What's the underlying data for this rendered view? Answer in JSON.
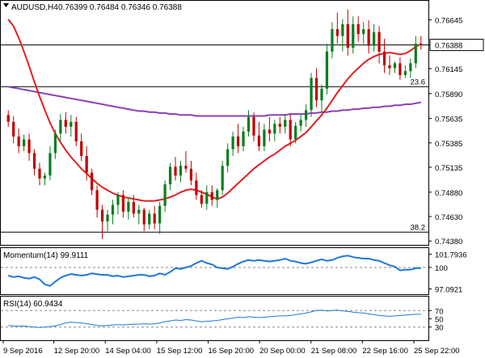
{
  "chart_data": [
    {
      "type": "candlestick",
      "header": {
        "symbol": "AUDUSD,H4",
        "ohlc": "0.76399 0.76484 0.76346 0.76388"
      },
      "y_ticks": [
        "0.76645",
        "0.76388",
        "0.76145",
        "0.75890",
        "0.75635",
        "0.75385",
        "0.75135",
        "0.74880",
        "0.74630",
        "0.74380"
      ],
      "y_tick_values": [
        0.76645,
        0.76388,
        0.76145,
        0.7589,
        0.75635,
        0.75385,
        0.75135,
        0.7488,
        0.7463,
        0.7438
      ],
      "ylim": [
        0.7434,
        0.7684
      ],
      "x_labels": [
        "9 Sep 2016",
        "12 Sep 20:00",
        "14 Sep 04:00",
        "15 Sep 12:00",
        "16 Sep 20:00",
        "20 Sep 00:00",
        "21 Sep 08:00",
        "22 Sep 16:00",
        "25 Sep 22:00"
      ],
      "current_price": 0.76388,
      "fib_levels": [
        {
          "label": "23.6",
          "value": 0.7596
        },
        {
          "label": "38.2",
          "value": 0.7447
        }
      ],
      "up_color": "#0a7d1e",
      "down_color": "#c00000",
      "candles": [
        [
          0.7567,
          0.7572,
          0.7555,
          0.756
        ],
        [
          0.756,
          0.7566,
          0.7538,
          0.7545
        ],
        [
          0.7545,
          0.7553,
          0.7528,
          0.7535
        ],
        [
          0.7535,
          0.7547,
          0.753,
          0.7542
        ],
        [
          0.7542,
          0.7548,
          0.752,
          0.7528
        ],
        [
          0.7528,
          0.7532,
          0.7505,
          0.7512
        ],
        [
          0.7512,
          0.7518,
          0.7495,
          0.7502
        ],
        [
          0.7502,
          0.7508,
          0.7495,
          0.7505
        ],
        [
          0.7505,
          0.7535,
          0.75,
          0.7528
        ],
        [
          0.7528,
          0.7552,
          0.7522,
          0.7548
        ],
        [
          0.7548,
          0.7568,
          0.754,
          0.7562
        ],
        [
          0.7562,
          0.757,
          0.7548,
          0.7555
        ],
        [
          0.7555,
          0.7567,
          0.7545,
          0.756
        ],
        [
          0.756,
          0.7565,
          0.7535,
          0.754
        ],
        [
          0.754,
          0.7548,
          0.752,
          0.7525
        ],
        [
          0.7525,
          0.7535,
          0.75,
          0.7508
        ],
        [
          0.7508,
          0.7512,
          0.7485,
          0.749
        ],
        [
          0.749,
          0.7495,
          0.7462,
          0.747
        ],
        [
          0.747,
          0.7475,
          0.744,
          0.7458
        ],
        [
          0.7458,
          0.747,
          0.7448,
          0.7465
        ],
        [
          0.7465,
          0.748,
          0.7455,
          0.7475
        ],
        [
          0.7475,
          0.7488,
          0.7465,
          0.7485
        ],
        [
          0.7485,
          0.749,
          0.7462,
          0.7468
        ],
        [
          0.7468,
          0.7482,
          0.746,
          0.7478
        ],
        [
          0.7478,
          0.7485,
          0.7462,
          0.7466
        ],
        [
          0.7466,
          0.7475,
          0.7455,
          0.747
        ],
        [
          0.747,
          0.7472,
          0.7448,
          0.7455
        ],
        [
          0.7455,
          0.747,
          0.745,
          0.7466
        ],
        [
          0.7466,
          0.7474,
          0.745,
          0.7456
        ],
        [
          0.7456,
          0.7478,
          0.7445,
          0.7474
        ],
        [
          0.7474,
          0.75,
          0.7468,
          0.7496
        ],
        [
          0.7496,
          0.7518,
          0.749,
          0.7514
        ],
        [
          0.7514,
          0.7524,
          0.75,
          0.7505
        ],
        [
          0.7505,
          0.752,
          0.7498,
          0.7515
        ],
        [
          0.7515,
          0.753,
          0.7508,
          0.7512
        ],
        [
          0.7512,
          0.752,
          0.7495,
          0.75
        ],
        [
          0.75,
          0.7508,
          0.748,
          0.7485
        ],
        [
          0.7485,
          0.749,
          0.7472,
          0.7476
        ],
        [
          0.7476,
          0.7495,
          0.747,
          0.7488
        ],
        [
          0.7488,
          0.7495,
          0.7474,
          0.748
        ],
        [
          0.748,
          0.7492,
          0.7472,
          0.749
        ],
        [
          0.749,
          0.752,
          0.7485,
          0.7515
        ],
        [
          0.7515,
          0.7538,
          0.7508,
          0.7532
        ],
        [
          0.7532,
          0.755,
          0.7525,
          0.7545
        ],
        [
          0.7545,
          0.7558,
          0.7528,
          0.7535
        ],
        [
          0.7535,
          0.7555,
          0.753,
          0.755
        ],
        [
          0.755,
          0.7572,
          0.7545,
          0.7565
        ],
        [
          0.7565,
          0.757,
          0.754,
          0.7546
        ],
        [
          0.7546,
          0.756,
          0.753,
          0.7535
        ],
        [
          0.7535,
          0.7558,
          0.753,
          0.7552
        ],
        [
          0.7552,
          0.7565,
          0.754,
          0.7548
        ],
        [
          0.7548,
          0.7562,
          0.754,
          0.7558
        ],
        [
          0.7558,
          0.7565,
          0.7548,
          0.7555
        ],
        [
          0.7555,
          0.7568,
          0.7548,
          0.7562
        ],
        [
          0.7562,
          0.7568,
          0.7535,
          0.7542
        ],
        [
          0.7542,
          0.756,
          0.7538,
          0.7556
        ],
        [
          0.7556,
          0.7568,
          0.755,
          0.7562
        ],
        [
          0.7562,
          0.7578,
          0.7555,
          0.7572
        ],
        [
          0.7572,
          0.761,
          0.7565,
          0.7605
        ],
        [
          0.7605,
          0.7615,
          0.7575,
          0.7582
        ],
        [
          0.7582,
          0.7598,
          0.757,
          0.7594
        ],
        [
          0.7594,
          0.764,
          0.7588,
          0.7632
        ],
        [
          0.7632,
          0.7662,
          0.7625,
          0.7655
        ],
        [
          0.7655,
          0.7672,
          0.764,
          0.7648
        ],
        [
          0.7648,
          0.7665,
          0.7632,
          0.766
        ],
        [
          0.766,
          0.7675,
          0.7628,
          0.7636
        ],
        [
          0.7636,
          0.7668,
          0.763,
          0.766
        ],
        [
          0.766,
          0.7668,
          0.7642,
          0.765
        ],
        [
          0.765,
          0.7662,
          0.764,
          0.7655
        ],
        [
          0.7655,
          0.7664,
          0.763,
          0.7638
        ],
        [
          0.7638,
          0.766,
          0.7632,
          0.7652
        ],
        [
          0.7652,
          0.7658,
          0.762,
          0.7632
        ],
        [
          0.7632,
          0.7645,
          0.761,
          0.7618
        ],
        [
          0.7618,
          0.7628,
          0.7608,
          0.7615
        ],
        [
          0.7615,
          0.7622,
          0.761,
          0.762
        ],
        [
          0.762,
          0.7626,
          0.7603,
          0.7608
        ],
        [
          0.7608,
          0.7618,
          0.7605,
          0.7612
        ],
        [
          0.7612,
          0.7625,
          0.7605,
          0.762
        ],
        [
          0.762,
          0.7648,
          0.7615,
          0.764
        ],
        [
          0.764,
          0.7648,
          0.7634,
          0.7639
        ]
      ],
      "sma20": [
        0.7665,
        0.7658,
        0.7646,
        0.7632,
        0.7617,
        0.7601,
        0.7586,
        0.7572,
        0.7559,
        0.7548,
        0.7539,
        0.7531,
        0.7524,
        0.7518,
        0.7512,
        0.7507,
        0.7502,
        0.7497,
        0.7493,
        0.749,
        0.7487,
        0.7485,
        0.7483,
        0.7482,
        0.7481,
        0.748,
        0.7479,
        0.7479,
        0.7479,
        0.748,
        0.7481,
        0.7483,
        0.7485,
        0.7488,
        0.749,
        0.7491,
        0.749,
        0.7488,
        0.7486,
        0.7483,
        0.7481,
        0.7483,
        0.7487,
        0.7492,
        0.7497,
        0.7502,
        0.7507,
        0.7512,
        0.7516,
        0.752,
        0.7524,
        0.7527,
        0.7531,
        0.7535,
        0.7538,
        0.7541,
        0.7545,
        0.7549,
        0.7555,
        0.7561,
        0.7567,
        0.7574,
        0.7582,
        0.759,
        0.7597,
        0.7604,
        0.761,
        0.7615,
        0.762,
        0.7624,
        0.7627,
        0.7629,
        0.763,
        0.7631,
        0.763,
        0.7629,
        0.763,
        0.7633,
        0.7637,
        0.764
      ],
      "sma200": [
        0.7596,
        0.7595,
        0.7594,
        0.7593,
        0.7592,
        0.7591,
        0.759,
        0.7589,
        0.7588,
        0.7587,
        0.7586,
        0.7585,
        0.7584,
        0.7583,
        0.7582,
        0.7581,
        0.758,
        0.7579,
        0.7578,
        0.7577,
        0.7576,
        0.7575,
        0.7574,
        0.7573,
        0.7572,
        0.7571,
        0.7571,
        0.757,
        0.757,
        0.7569,
        0.7569,
        0.7568,
        0.7568,
        0.7567,
        0.7567,
        0.7567,
        0.7566,
        0.7566,
        0.7566,
        0.7566,
        0.7566,
        0.7566,
        0.7566,
        0.7566,
        0.7566,
        0.7566,
        0.7566,
        0.7566,
        0.7566,
        0.7566,
        0.7567,
        0.7567,
        0.7567,
        0.7567,
        0.7568,
        0.7568,
        0.7568,
        0.7568,
        0.7569,
        0.7569,
        0.757,
        0.757,
        0.7571,
        0.7571,
        0.7572,
        0.7572,
        0.7573,
        0.7573,
        0.7574,
        0.7574,
        0.7575,
        0.7575,
        0.7576,
        0.7576,
        0.7577,
        0.7577,
        0.7578,
        0.7578,
        0.7579,
        0.758
      ],
      "sma20_color": "#e02020",
      "sma200_color": "#8a3fb6"
    },
    {
      "type": "line",
      "title": "Momentum(14) 99.9111",
      "y_ticks": [
        "101.7936",
        "100",
        "97.0921"
      ],
      "y_tick_values": [
        101.7936,
        100,
        97.0921
      ],
      "ylim": [
        96.5,
        102.4
      ],
      "reference_level": 100,
      "color": "#1e78d7",
      "values": [
        98.9,
        98.7,
        98.8,
        98.6,
        98.5,
        98.7,
        98.4,
        97.7,
        97.5,
        98.1,
        98.6,
        98.9,
        99.1,
        99.0,
        98.9,
        99.0,
        99.2,
        99.1,
        99.0,
        99.0,
        98.8,
        98.9,
        98.7,
        98.8,
        98.9,
        99.0,
        99.0,
        98.8,
        98.9,
        99.2,
        99.0,
        99.4,
        99.9,
        99.8,
        100.0,
        100.2,
        100.6,
        100.9,
        100.6,
        100.4,
        100.0,
        99.9,
        99.8,
        100.1,
        100.5,
        100.8,
        101.0,
        100.9,
        101.0,
        100.9,
        100.8,
        100.9,
        101.0,
        101.2,
        100.9,
        100.8,
        100.6,
        100.5,
        100.7,
        100.9,
        101.1,
        100.9,
        101.0,
        101.3,
        101.5,
        101.6,
        101.4,
        101.3,
        101.2,
        101.2,
        101.0,
        100.9,
        100.6,
        100.3,
        100.1,
        99.6,
        99.7,
        99.7,
        99.9,
        99.9
      ]
    },
    {
      "type": "line",
      "title": "RSI(14) 60.9434",
      "y_ticks": [
        "70",
        "50",
        "30"
      ],
      "y_tick_values": [
        70,
        50,
        30
      ],
      "ylim": [
        0,
        100
      ],
      "levels": [
        70,
        30
      ],
      "color": "#1e78d7",
      "values": [
        34,
        33,
        32,
        33,
        31,
        30,
        29,
        30,
        31,
        33,
        36,
        40,
        42,
        41,
        40,
        38,
        36,
        34,
        33,
        34,
        35,
        36,
        35,
        36,
        37,
        37,
        38,
        37,
        38,
        40,
        43,
        45,
        47,
        46,
        48,
        47,
        45,
        43,
        44,
        45,
        46,
        48,
        50,
        52,
        54,
        53,
        55,
        54,
        53,
        54,
        55,
        56,
        57,
        57,
        58,
        60,
        62,
        64,
        67,
        70,
        71,
        69,
        70,
        71,
        69,
        68,
        66,
        65,
        64,
        62,
        60,
        58,
        57,
        56,
        57,
        58,
        59,
        60,
        61,
        61
      ]
    }
  ]
}
